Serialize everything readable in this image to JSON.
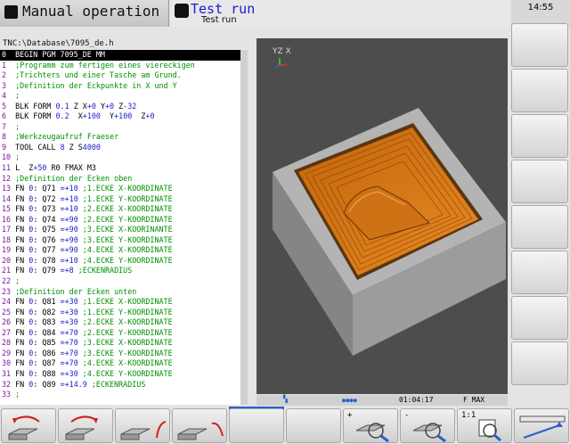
{
  "header": {
    "mode_title": "Manual operation",
    "run_title": "Test run",
    "run_subtitle": "Test run",
    "clock": "14:55"
  },
  "program": {
    "path": "TNC:\\Database\\7095_de.h",
    "lines": [
      {
        "n": "0",
        "html": "  BEGIN PGM 7095_DE MM"
      },
      {
        "n": "1",
        "html": "  <span class='c'>;Programm zum fertigen eines viereckigen</span>"
      },
      {
        "n": "2",
        "html": "  <span class='c'>;Trichters und einer Tasche am Grund.</span>"
      },
      {
        "n": "3",
        "html": "  <span class='c'>;Definition der Eckpunkte in X und Y</span>"
      },
      {
        "n": "4",
        "html": "  <span class='c'>;</span>"
      },
      {
        "n": "5",
        "html": "  BLK FORM <span class='v'>0.1</span> Z X<span class='v'>+0</span> Y<span class='v'>+0</span> Z<span class='v'>-32</span>"
      },
      {
        "n": "6",
        "html": "  BLK FORM <span class='v'>0.2</span>  X<span class='v'>+100</span>  Y<span class='v'>+100</span>  Z<span class='v'>+0</span>"
      },
      {
        "n": "7",
        "html": "  <span class='c'>;</span>"
      },
      {
        "n": "8",
        "html": "  <span class='c'>;Werkzeugaufruf Fraeser</span>"
      },
      {
        "n": "9",
        "html": "  TOOL CALL <span class='v'>8</span> Z S<span class='v'>4000</span>"
      },
      {
        "n": "10",
        "html": " <span class='c'>;</span>"
      },
      {
        "n": "11",
        "html": " L  Z<span class='v'>+50</span> R0 FMAX M3"
      },
      {
        "n": "12",
        "html": " <span class='c'>;Definition der Ecken oben</span>"
      },
      {
        "n": "13",
        "html": " FN <span class='v'>0</span>: Q71 <span class='v'>=+10</span> <span class='c'>;1.ECKE X-KOORDINATE</span>"
      },
      {
        "n": "14",
        "html": " FN <span class='v'>0</span>: Q72 <span class='v'>=+10</span> <span class='c'>;1.ECKE Y-KOORDINATE</span>"
      },
      {
        "n": "15",
        "html": " FN <span class='v'>0</span>: Q73 <span class='v'>=+10</span> <span class='c'>;2.ECKE X-KOORDINATE</span>"
      },
      {
        "n": "16",
        "html": " FN <span class='v'>0</span>: Q74 <span class='v'>=+90</span> <span class='c'>;2.ECKE Y-KOORDINATE</span>"
      },
      {
        "n": "17",
        "html": " FN <span class='v'>0</span>: Q75 <span class='v'>=+90</span> <span class='c'>;3.ECKE X-KOORINANTE</span>"
      },
      {
        "n": "18",
        "html": " FN <span class='v'>0</span>: Q76 <span class='v'>=+90</span> <span class='c'>;3.ECKE Y-KOORDINATE</span>"
      },
      {
        "n": "19",
        "html": " FN <span class='v'>0</span>: Q77 <span class='v'>=+90</span> <span class='c'>;4.ECKE X-KOORDINATE</span>"
      },
      {
        "n": "20",
        "html": " FN <span class='v'>0</span>: Q78 <span class='v'>=+10</span> <span class='c'>;4.ECKE Y-KOORDINATE</span>"
      },
      {
        "n": "21",
        "html": " FN <span class='v'>0</span>: Q79 <span class='v'>=+8</span> <span class='c'>;ECKENRADIUS</span>"
      },
      {
        "n": "22",
        "html": " <span class='c'>;</span>"
      },
      {
        "n": "23",
        "html": " <span class='c'>;Definition der Ecken unten</span>"
      },
      {
        "n": "24",
        "html": " FN <span class='v'>0</span>: Q81 <span class='v'>=+30</span> <span class='c'>;1.ECKE X-KOORDINATE</span>"
      },
      {
        "n": "25",
        "html": " FN <span class='v'>0</span>: Q82 <span class='v'>=+30</span> <span class='c'>;1.ECKE Y-KOORDINATE</span>"
      },
      {
        "n": "26",
        "html": " FN <span class='v'>0</span>: Q83 <span class='v'>=+30</span> <span class='c'>;2.ECKE X-KOORDINATE</span>"
      },
      {
        "n": "27",
        "html": " FN <span class='v'>0</span>: Q84 <span class='v'>=+70</span> <span class='c'>;2.ECKE Y-KOORDINATE</span>"
      },
      {
        "n": "28",
        "html": " FN <span class='v'>0</span>: Q85 <span class='v'>=+70</span> <span class='c'>;3.ECKE X-KOORDINATE</span>"
      },
      {
        "n": "29",
        "html": " FN <span class='v'>0</span>: Q86 <span class='v'>=+70</span> <span class='c'>;3.ECKE Y-KOORDINATE</span>"
      },
      {
        "n": "30",
        "html": " FN <span class='v'>0</span>: Q87 <span class='v'>=+70</span> <span class='c'>;4.ECKE X-KOORDINATE</span>"
      },
      {
        "n": "31",
        "html": " FN <span class='v'>0</span>: Q88 <span class='v'>=+30</span> <span class='c'>;4.ECKE Y-KOORDINATE</span>"
      },
      {
        "n": "32",
        "html": " FN <span class='v'>0</span>: Q89 <span class='v'>=+14.9</span> <span class='c'>;ECKENRADIUS</span>"
      },
      {
        "n": "33",
        "html": " <span class='c'>;</span>"
      }
    ]
  },
  "view": {
    "axis_label": "YZ X"
  },
  "status": {
    "time": "01:04:17",
    "feed": "F MAX"
  },
  "bottom_softkeys": {
    "plus_label": "+",
    "minus_label": "-",
    "ratio_label": "1:1"
  }
}
